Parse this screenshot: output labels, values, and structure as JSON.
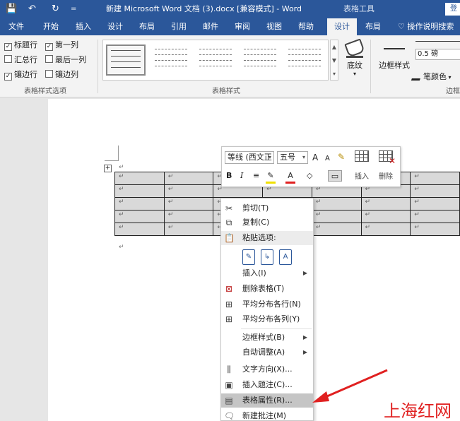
{
  "titlebar": {
    "save_icon": "save-icon",
    "undo_icon": "undo-icon",
    "redo_icon": "redo-icon",
    "customize_icon": "customize-icon",
    "title": "新建 Microsoft Word 文档 (3).docx [兼容模式] - Word",
    "context_tools": "表格工具",
    "login": "登"
  },
  "tabs": [
    {
      "label": "文件"
    },
    {
      "label": "开始"
    },
    {
      "label": "插入"
    },
    {
      "label": "设计"
    },
    {
      "label": "布局"
    },
    {
      "label": "引用"
    },
    {
      "label": "邮件"
    },
    {
      "label": "审阅"
    },
    {
      "label": "视图"
    },
    {
      "label": "帮助"
    },
    {
      "label": "设计",
      "active": true
    },
    {
      "label": "布局"
    }
  ],
  "tell_me": "操作说明搜索",
  "ribbon": {
    "options": [
      {
        "label": "标题行",
        "checked": true
      },
      {
        "label": "第一列",
        "checked": true
      },
      {
        "label": "汇总行",
        "checked": false
      },
      {
        "label": "最后一列",
        "checked": false
      },
      {
        "label": "镶边行",
        "checked": true
      },
      {
        "label": "镶边列",
        "checked": false
      }
    ],
    "options_group_label": "表格样式选项",
    "styles_group_label": "表格样式",
    "shading_label": "底纹",
    "border_styles_label": "边框样式",
    "border_weight": "0.5 磅",
    "pen_color_label": "笔颜色",
    "borders_group_label": "边框"
  },
  "mini_toolbar": {
    "font": "等线 (西文正",
    "size": "五号",
    "grow_font": "A",
    "shrink_font": "A",
    "bold": "B",
    "italic": "I",
    "align": "≡",
    "font_color": "A",
    "insert_label": "插入",
    "delete_label": "删除"
  },
  "context_menu": {
    "cut": "剪切(T)",
    "copy": "复制(C)",
    "paste_options": "粘贴选项:",
    "insert": "插入(I)",
    "delete_table": "删除表格(T)",
    "distribute_rows": "平均分布各行(N)",
    "distribute_cols": "平均分布各列(Y)",
    "border_styles": "边框样式(B)",
    "autofit": "自动调整(A)",
    "text_direction": "文字方向(X)...",
    "insert_caption": "插入题注(C)...",
    "table_properties": "表格属性(R)...",
    "new_comment": "新建批注(M)"
  },
  "table": {
    "rows": 5,
    "cols": 7,
    "cell_mark": "↵"
  },
  "watermark": "上海红网",
  "colors": {
    "accent": "#2b579a",
    "highlight_menu": "#c5c5c5",
    "arrow": "#e02020"
  }
}
